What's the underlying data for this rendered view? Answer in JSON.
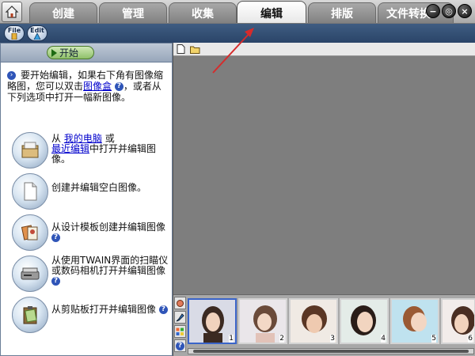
{
  "tabs": [
    {
      "label": "创建",
      "active": false
    },
    {
      "label": "管理",
      "active": false
    },
    {
      "label": "收集",
      "active": false
    },
    {
      "label": "编辑",
      "active": true
    },
    {
      "label": "排版",
      "active": false
    },
    {
      "label": "文件转换",
      "active": false
    }
  ],
  "window_controls": {
    "minimize": "−",
    "restore": "◎",
    "close": "×"
  },
  "subbar": {
    "file_label": "File",
    "edit_label": "Edit"
  },
  "left_panel": {
    "start_label": "开始",
    "intro": {
      "part1": "要开始编辑，如果右下角有图像缩略图，您可以双击",
      "link": "图像盒",
      "part2": "，或者从下列选项中打开一幅新图像。"
    },
    "options": [
      {
        "prefix": "从",
        "link1": "我的电脑",
        "mid": "或",
        "link2": "最近编辑",
        "suffix": "中打开并编辑图像。",
        "help": false
      },
      {
        "text": "创建并编辑空白图像。",
        "help": false
      },
      {
        "text": "从设计模板创建并编辑图像",
        "help": true
      },
      {
        "text": "从使用TWAIN界面的扫瞄仪或数码相机打开并编辑图像",
        "help": true
      },
      {
        "text": "从剪贴板打开并编辑图像",
        "help": true
      }
    ]
  },
  "filmstrip": {
    "thumbnails": [
      {
        "number": "1",
        "selected": true
      },
      {
        "number": "2",
        "selected": false
      },
      {
        "number": "3",
        "selected": false
      },
      {
        "number": "4",
        "selected": false
      },
      {
        "number": "5",
        "selected": false
      },
      {
        "number": "6",
        "selected": false
      }
    ]
  },
  "colors": {
    "canvas_bg": "#7e7e7e",
    "subbar_bg": "#2a4468",
    "start_green": "#8fc06a",
    "link": "#0000cc",
    "annotation_arrow": "#d62b2b"
  }
}
